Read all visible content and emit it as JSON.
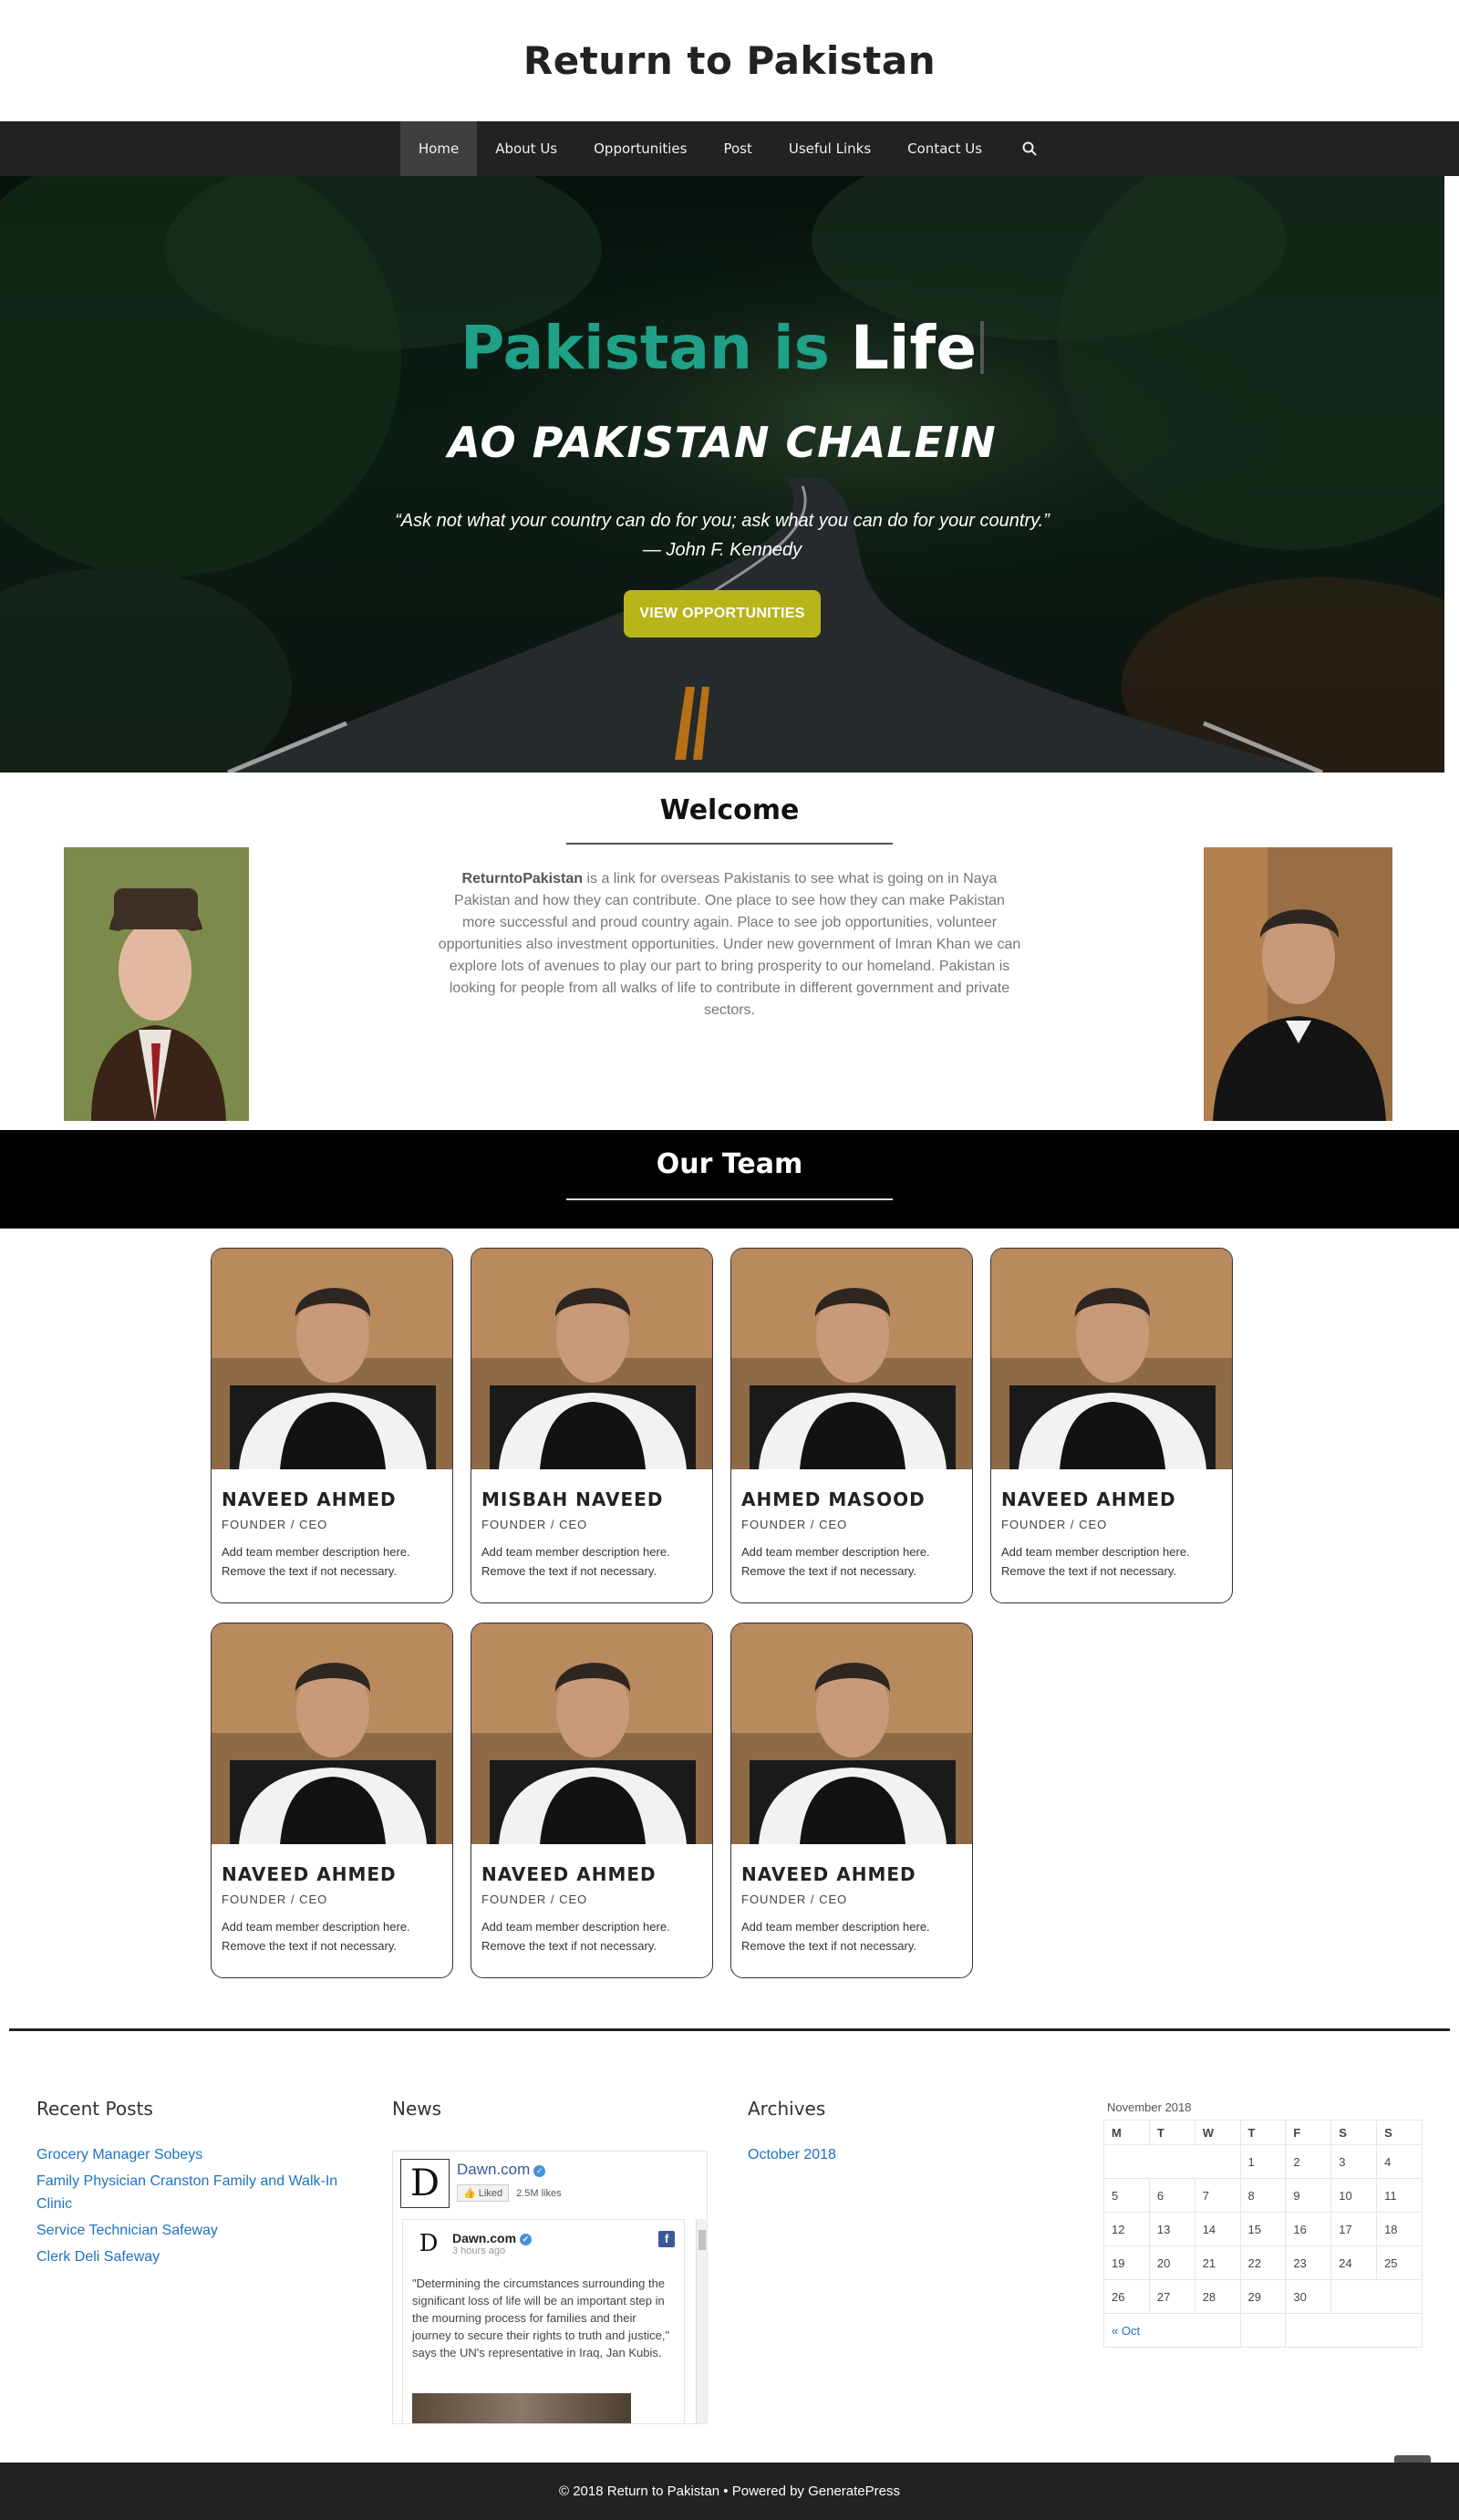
{
  "site": {
    "title": "Return to Pakistan"
  },
  "nav": {
    "items": [
      {
        "label": "Home"
      },
      {
        "label": "About Us"
      },
      {
        "label": "Opportunities"
      },
      {
        "label": "Post"
      },
      {
        "label": "Useful Links"
      },
      {
        "label": "Contact Us"
      }
    ],
    "search_icon": "search-icon"
  },
  "hero": {
    "line1_part1": "Pakistan is ",
    "line1_part2": "Life",
    "line2": "AO PAKISTAN CHALEIN",
    "quote": "“Ask not what your country can do for you; ask what you can do for your country.”",
    "quote_author": "— John F. Kennedy",
    "button_label": "VIEW OPPORTUNITIES",
    "colors": {
      "accent": "#1fa087",
      "button": "#b8b51b"
    }
  },
  "welcome": {
    "title": "Welcome",
    "brand": "ReturntoPakistan",
    "text": " is a link for overseas Pakistanis to see what is going on in Naya Pakistan and how they can contribute. One place to see how they can make Pakistan more successful and proud country again. Place to see job opportunities, volunteer opportunities also investment opportunities. Under new government of Imran Khan we can explore lots of avenues to play our part to bring prosperity to our homeland. Pakistan is looking for people from all walks of life to contribute in different government and private sectors."
  },
  "team": {
    "title": "Our Team",
    "members": [
      {
        "name": "NAVEED AHMED",
        "role": "FOUNDER / CEO",
        "desc": "Add team member description here. Remove the text if not necessary."
      },
      {
        "name": "MISBAH NAVEED",
        "role": "FOUNDER / CEO",
        "desc": "Add team member description here. Remove the text if not necessary."
      },
      {
        "name": "AHMED MASOOD",
        "role": "FOUNDER / CEO",
        "desc": "Add team member description here. Remove the text if not necessary."
      },
      {
        "name": "NAVEED AHMED",
        "role": "FOUNDER / CEO",
        "desc": "Add team member description here. Remove the text if not necessary."
      },
      {
        "name": "NAVEED AHMED",
        "role": "FOUNDER / CEO",
        "desc": "Add team member description here. Remove the text if not necessary."
      },
      {
        "name": "NAVEED AHMED",
        "role": "FOUNDER / CEO",
        "desc": "Add team member description here. Remove the text if not necessary."
      },
      {
        "name": "NAVEED AHMED",
        "role": "FOUNDER / CEO",
        "desc": "Add team member description here. Remove the text if not necessary."
      }
    ]
  },
  "widgets": {
    "recent_posts": {
      "title": "Recent Posts",
      "links": [
        "Grocery Manager Sobeys",
        "Family Physician Cranston Family and Walk-In Clinic",
        "Service Technician Safeway",
        "Clerk Deli Safeway"
      ]
    },
    "news": {
      "title": "News",
      "fb_page": "Dawn.com",
      "liked": "Liked",
      "likes": "2.5M likes",
      "post_author": "Dawn.com",
      "post_time": "3 hours ago",
      "post_text": "\"Determining the circumstances surrounding the significant loss of life will be an important step in the mourning process for families and their journey to secure their rights to truth and justice,\" says the UN's representative in Iraq, Jan Kubis."
    },
    "archives": {
      "title": "Archives",
      "links": [
        "October 2018"
      ]
    },
    "calendar": {
      "caption": "November 2018",
      "days": [
        "M",
        "T",
        "W",
        "T",
        "F",
        "S",
        "S"
      ],
      "weeks": [
        [
          "",
          "",
          "",
          "1",
          "2",
          "3",
          "4"
        ],
        [
          "5",
          "6",
          "7",
          "8",
          "9",
          "10",
          "11"
        ],
        [
          "12",
          "13",
          "14",
          "15",
          "16",
          "17",
          "18"
        ],
        [
          "19",
          "20",
          "21",
          "22",
          "23",
          "24",
          "25"
        ],
        [
          "26",
          "27",
          "28",
          "29",
          "30",
          "",
          ""
        ]
      ],
      "prev": "« Oct"
    }
  },
  "footer": {
    "text": "© 2018 Return to Pakistan • Powered by GeneratePress"
  },
  "scroll_top_icon": "chevron-up-icon"
}
